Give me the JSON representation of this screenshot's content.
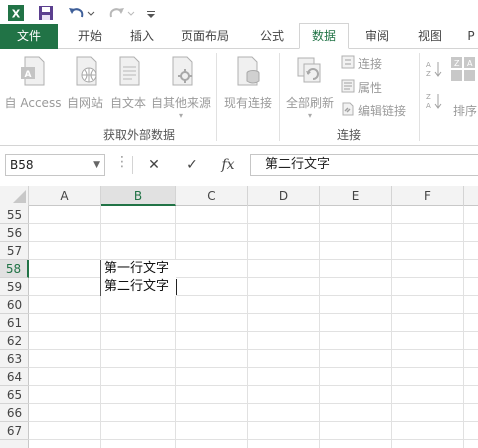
{
  "qat": {
    "app_icon": "excel-logo-icon",
    "save_icon": "save-icon",
    "undo_icon": "undo-icon",
    "redo_icon": "redo-icon",
    "customize_icon": "customize-qat-icon"
  },
  "tabs": [
    {
      "label": "文件"
    },
    {
      "label": "开始"
    },
    {
      "label": "插入"
    },
    {
      "label": "页面布局"
    },
    {
      "label": "公式"
    },
    {
      "label": "数据"
    },
    {
      "label": "审阅"
    },
    {
      "label": "视图"
    },
    {
      "label": "P"
    }
  ],
  "ribbon": {
    "get_external": {
      "group_label": "获取外部数据",
      "buttons": [
        {
          "label": "自 Access",
          "icon": "access-db-icon"
        },
        {
          "label": "自网站",
          "icon": "web-globe-icon"
        },
        {
          "label": "自文本",
          "icon": "text-file-icon"
        },
        {
          "label": "自其他来源",
          "icon": "other-sources-icon"
        },
        {
          "label": "现有连接",
          "icon": "existing-connections-icon"
        }
      ]
    },
    "connections": {
      "group_label": "连接",
      "refresh_label": "全部刷新",
      "small": [
        {
          "label": "连接",
          "icon": "connections-icon"
        },
        {
          "label": "属性",
          "icon": "properties-icon"
        },
        {
          "label": "编辑链接",
          "icon": "edit-links-icon"
        }
      ]
    },
    "sort": {
      "sort_label": "排序"
    }
  },
  "formula_bar": {
    "name_box": "B58",
    "cancel_glyph": "✕",
    "enter_glyph": "✓",
    "fx_glyph": "fx",
    "content": "第二行文字"
  },
  "grid": {
    "columns": [
      "A",
      "B",
      "C",
      "D",
      "E",
      "F"
    ],
    "selected_column": "B",
    "rows": [
      "55",
      "56",
      "57",
      "58",
      "59",
      "60",
      "61",
      "62",
      "63",
      "64",
      "65",
      "66",
      "67"
    ],
    "selected_row": "58",
    "cell_b58_line1": "第一行文字",
    "cell_b58_line2": "第二行文字"
  },
  "colors": {
    "accent": "#217346",
    "file_tab": "#217346"
  }
}
